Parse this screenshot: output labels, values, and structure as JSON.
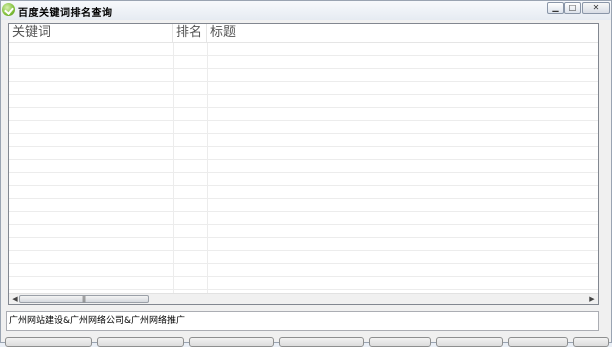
{
  "window": {
    "title": "百度关键词排名查询",
    "min_glyph": "▁",
    "max_glyph": "□",
    "close_glyph": "✕"
  },
  "listview": {
    "columns": [
      "关键词",
      "排名",
      "标题"
    ],
    "rows": []
  },
  "scrollbar": {
    "left_arrow": "◀",
    "right_arrow": "▶",
    "grip": "|||"
  },
  "keywords_input": {
    "value": "广州网站建设&广州网络公司&广州网络推广"
  },
  "buttons": [
    {
      "label": ""
    },
    {
      "label": ""
    },
    {
      "label": ""
    },
    {
      "label": ""
    },
    {
      "label": ""
    },
    {
      "label": ""
    },
    {
      "label": ""
    },
    {
      "label": ""
    }
  ]
}
